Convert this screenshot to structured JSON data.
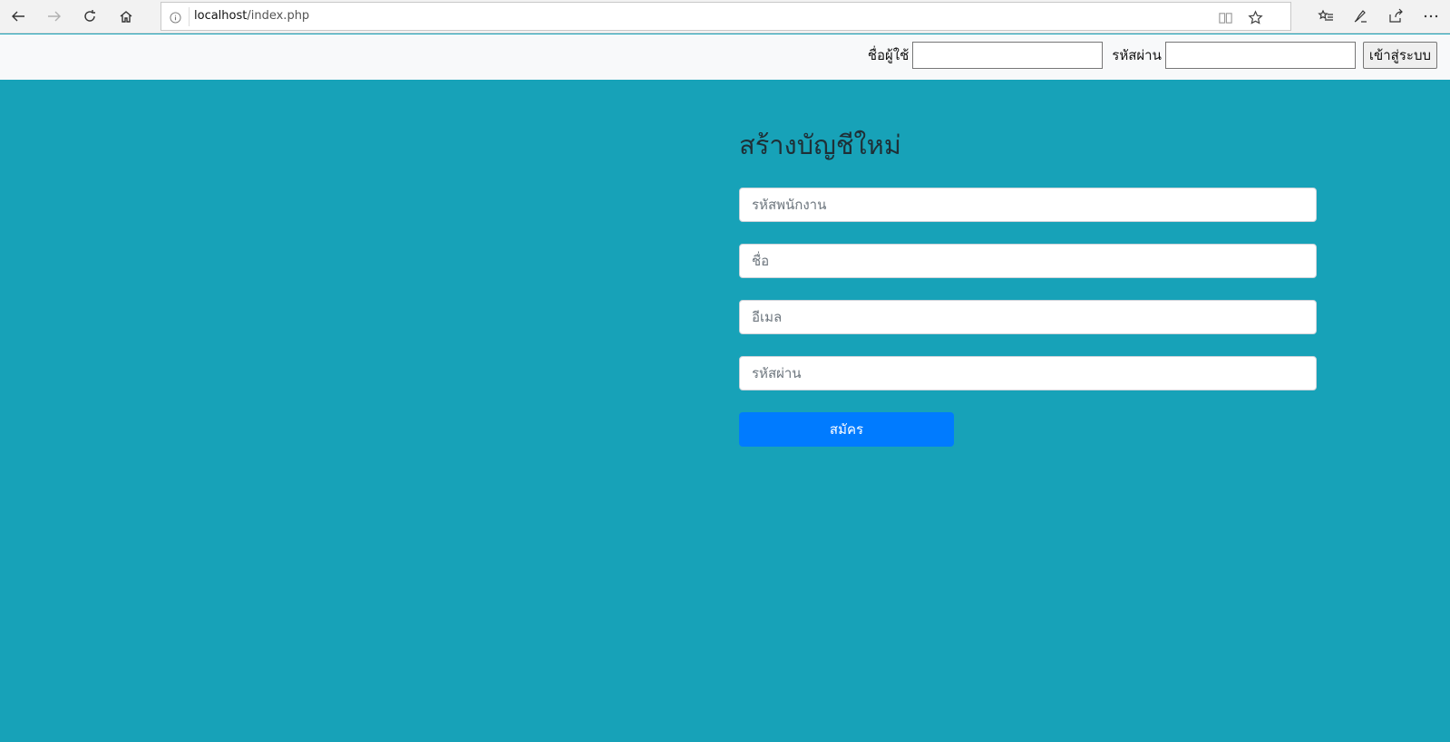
{
  "browser": {
    "url_host": "localhost",
    "url_path": "/index.php",
    "icons": [
      "back-arrow-icon",
      "forward-arrow-icon",
      "refresh-icon",
      "home-icon",
      "info-icon",
      "reading-view-icon",
      "favorite-star-icon",
      "favorites-list-icon",
      "pen-icon",
      "share-icon",
      "more-icon"
    ]
  },
  "navbar": {
    "username_label": "ชื่อผู้ใช้",
    "username_value": "",
    "password_label": "รหัสผ่าน",
    "password_value": "",
    "login_button": "เข้าสู่ระบบ"
  },
  "register": {
    "title": "สร้างบัญชีใหม่",
    "employee_id_placeholder": "รหัสพนักงาน",
    "name_placeholder": "ชื่อ",
    "email_placeholder": "อีเมล",
    "password_placeholder": "รหัสผ่าน",
    "submit_label": "สมัคร"
  },
  "colors": {
    "page_background": "#17a2b8",
    "navbar_background": "#f8f9fa",
    "primary_button": "#007bff"
  }
}
